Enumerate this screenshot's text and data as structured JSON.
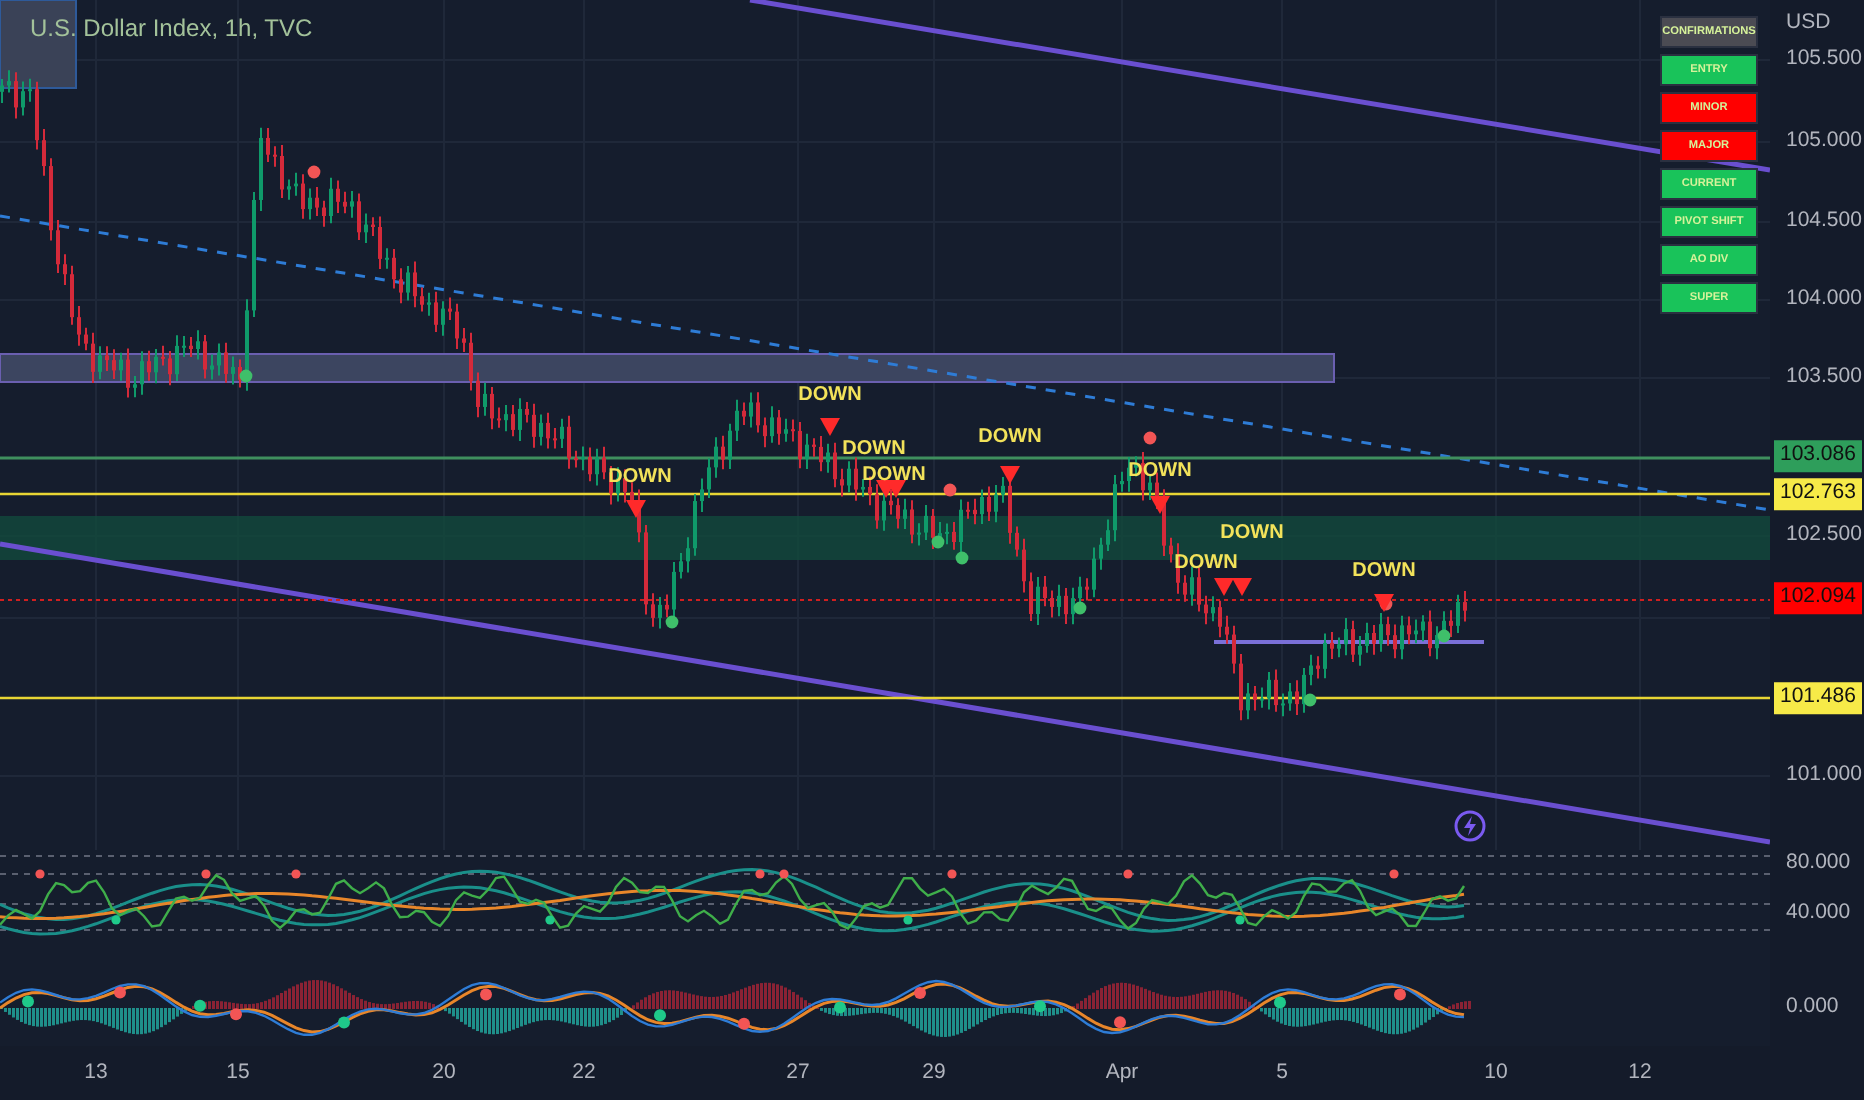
{
  "chart_title": "U.S. Dollar Index, 1h, TVC",
  "signals": [
    {
      "label": "DOWN"
    },
    {
      "label": "DOWN"
    },
    {
      "label": "DOWN"
    },
    {
      "label": "DOWN"
    },
    {
      "label": "DOWN"
    },
    {
      "label": "DOWN"
    },
    {
      "label": "DOWN"
    },
    {
      "label": "DOWN"
    },
    {
      "label": "DOWN"
    }
  ],
  "confirmations_panel": [
    {
      "label": "CONFIRMATIONS",
      "color": "#4b4b53"
    },
    {
      "label": "ENTRY",
      "color": "#19c35a"
    },
    {
      "label": "MINOR",
      "color": "#ff0000"
    },
    {
      "label": "MAJOR",
      "color": "#ff0000"
    },
    {
      "label": "CURRENT",
      "color": "#19c35a"
    },
    {
      "label": "PIVOT SHIFT",
      "color": "#19c35a"
    },
    {
      "label": "AO DIV",
      "color": "#19c35a"
    },
    {
      "label": "SUPER",
      "color": "#19c35a"
    }
  ],
  "price_axis": {
    "currency": "USD",
    "ticks": [
      "105.500",
      "105.000",
      "104.500",
      "104.000",
      "103.500",
      "102.500",
      "101.000"
    ]
  },
  "price_tags": [
    {
      "value": "103.086",
      "color": "#2e9e5b"
    },
    {
      "value": "102.763",
      "color": "#f7ea48"
    },
    {
      "value": "102.094",
      "color": "#ff0000"
    },
    {
      "value": "101.486",
      "color": "#f7ea48"
    }
  ],
  "indicator_axis": [
    "80.000",
    "40.000"
  ],
  "oscillator_axis": [
    "0.000"
  ],
  "time_axis": [
    "13",
    "15",
    "20",
    "22",
    "27",
    "29",
    "Apr",
    "5",
    "10",
    "12"
  ]
}
